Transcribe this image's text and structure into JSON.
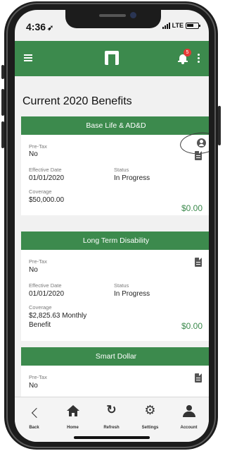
{
  "status_bar": {
    "time": "4:36",
    "network": "LTE"
  },
  "app_bar": {
    "notification_count": "5"
  },
  "page": {
    "title": "Current 2020 Benefits"
  },
  "cards": [
    {
      "title": "Base Life & AD&D",
      "pretax_label": "Pre-Tax",
      "pretax_value": "No",
      "effective_date_label": "Effective Date",
      "effective_date_value": "01/01/2020",
      "status_label": "Status",
      "status_value": "In Progress",
      "coverage_label": "Coverage",
      "coverage_value": "$50,000.00",
      "amount": "$0.00"
    },
    {
      "title": "Long Term Disability",
      "pretax_label": "Pre-Tax",
      "pretax_value": "No",
      "effective_date_label": "Effective Date",
      "effective_date_value": "01/01/2020",
      "status_label": "Status",
      "status_value": "In Progress",
      "coverage_label": "Coverage",
      "coverage_value_line1": "$2,825.63 Monthly",
      "coverage_value_line2": "Benefit",
      "amount": "$0.00"
    },
    {
      "title": "Smart Dollar",
      "pretax_label": "Pre-Tax",
      "pretax_value": "No"
    }
  ],
  "tabs": [
    {
      "label": "Back",
      "icon": "chevron-left-icon"
    },
    {
      "label": "Home",
      "icon": "home-icon"
    },
    {
      "label": "Refresh",
      "icon": "refresh-icon"
    },
    {
      "label": "Settings",
      "icon": "gear-icon"
    },
    {
      "label": "Account",
      "icon": "account-icon"
    }
  ],
  "colors": {
    "brand_green": "#3c8a4d",
    "badge_red": "#e53935"
  }
}
